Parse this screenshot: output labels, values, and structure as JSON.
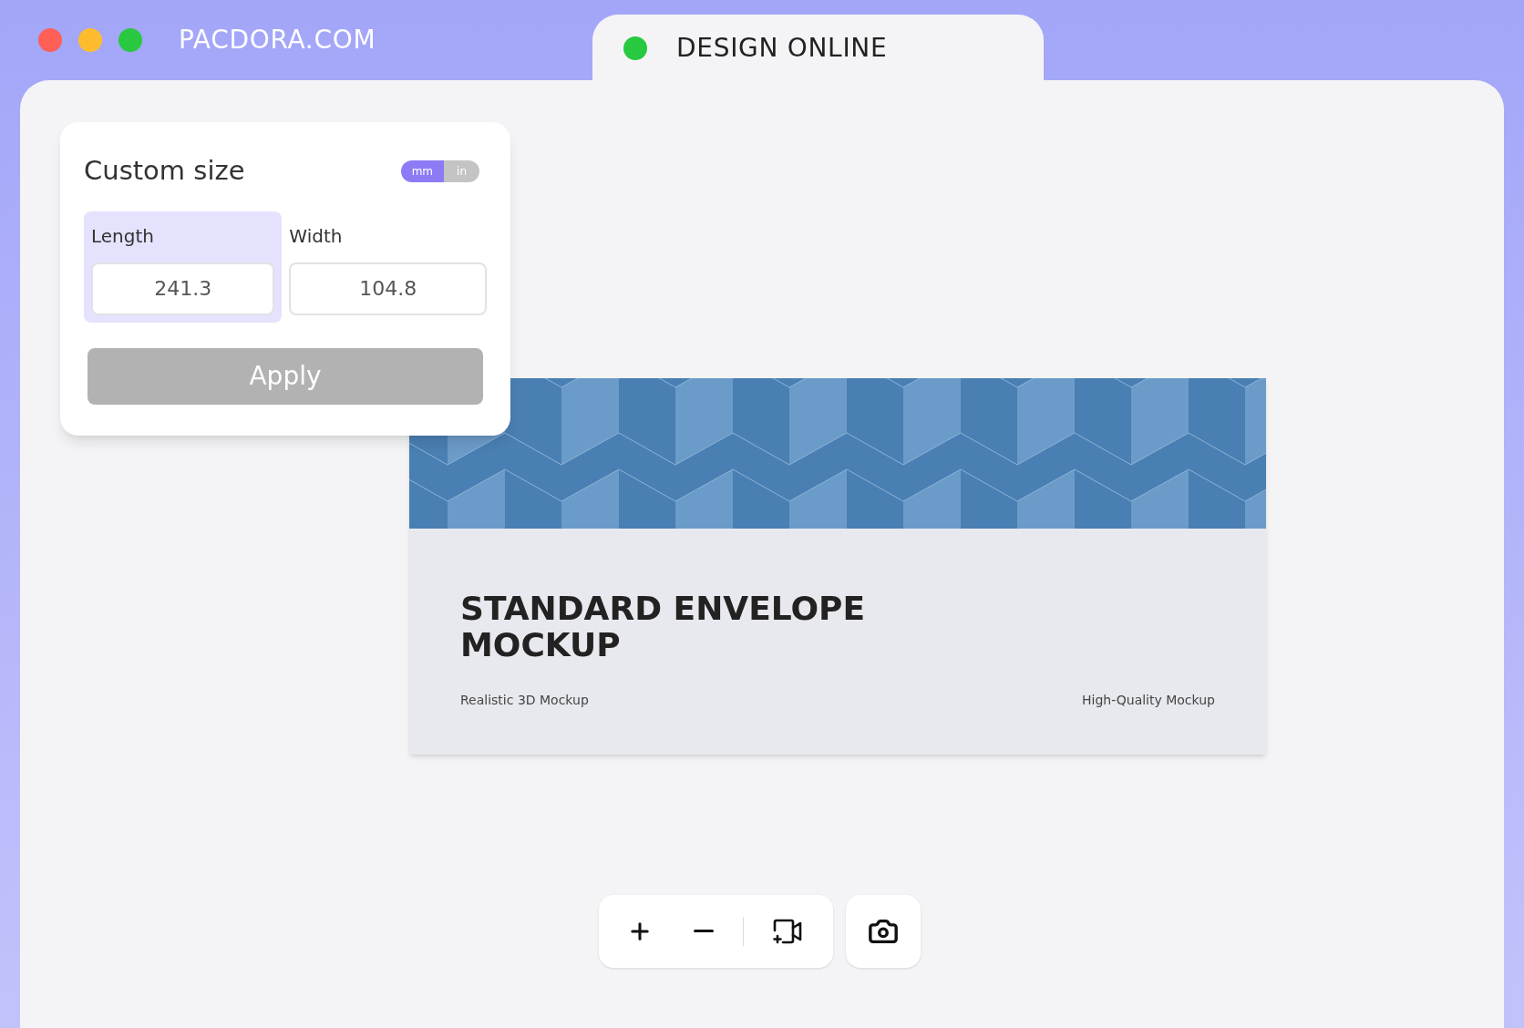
{
  "window": {
    "dots": [
      {
        "color": "#fe5f57"
      },
      {
        "color": "#fdbc2e"
      },
      {
        "color": "#28c840"
      }
    ],
    "title": "PACDORA.COM"
  },
  "tab": {
    "label": "DESIGN ONLINE",
    "color": "#28c840"
  },
  "panel": {
    "title": "Custom size",
    "units": [
      {
        "label": "mm",
        "selected": true
      },
      {
        "label": "in",
        "selected": false
      }
    ],
    "fields": [
      {
        "label": "Length",
        "value": "241.3",
        "selected": true
      },
      {
        "label": "Width",
        "value": "104.8",
        "selected": false
      }
    ],
    "apply": {
      "label": "Apply",
      "disabled": true
    }
  },
  "envelope": {
    "heading": "STANDARD ENVELOPE MOCKUP",
    "left_note": "Realistic 3D Mockup",
    "right_note": "High-Quality Mockup"
  },
  "toolbar": [
    {
      "kind": "zoom-in"
    },
    {
      "kind": "zoom-out"
    },
    {
      "kind": "divider"
    },
    {
      "kind": "record"
    }
  ],
  "camera": {
    "kind": "camera"
  }
}
